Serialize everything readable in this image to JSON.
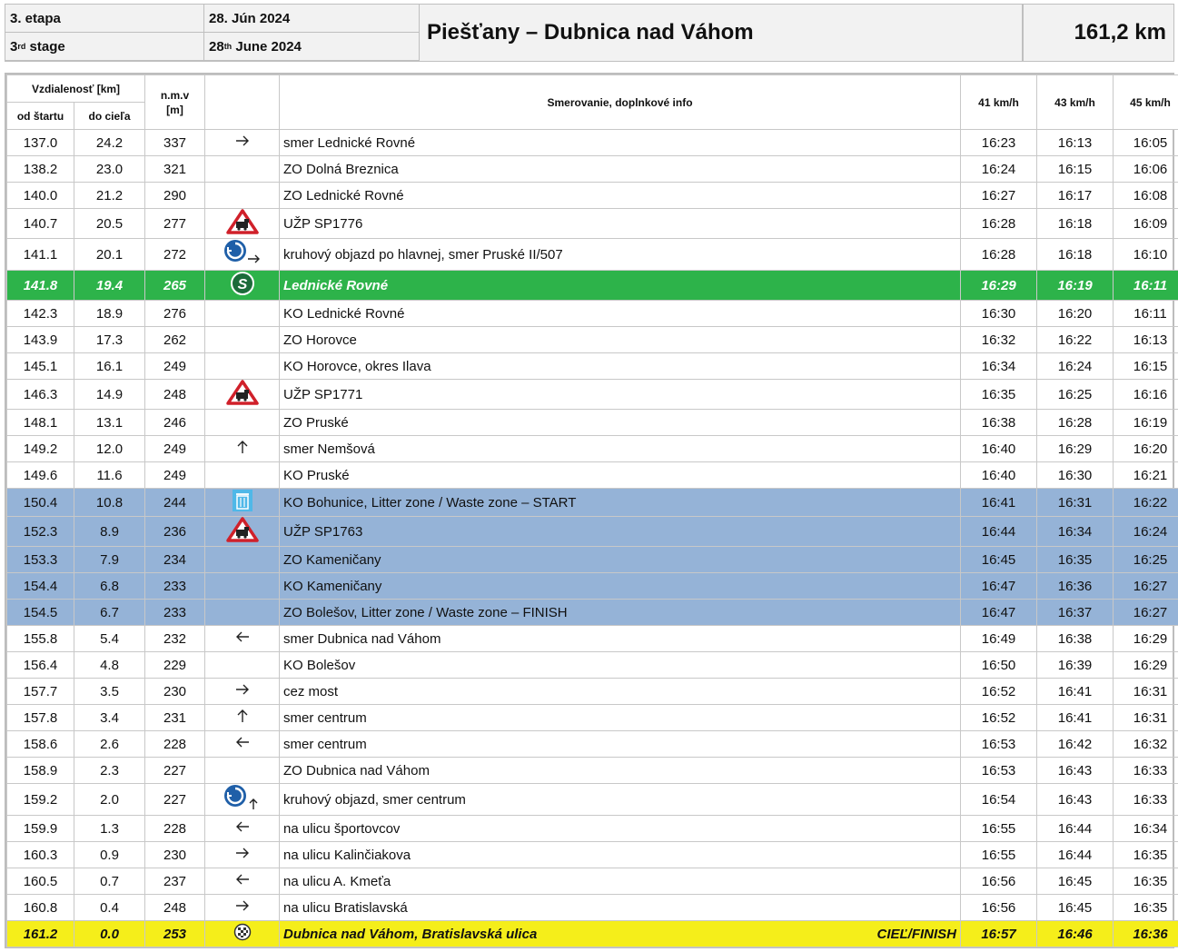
{
  "header": {
    "etapa_sk": "3. etapa",
    "etapa_en_num": "3",
    "etapa_en_sup": "rd",
    "etapa_en_word": " stage",
    "date_sk": "28. Jún 2024",
    "date_en_num": "28",
    "date_en_sup": "th",
    "date_en_rest": " June 2024",
    "title": "Piešťany – Dubnica nad Váhom",
    "distance": "161,2 km"
  },
  "columns": {
    "vzdialenost": "Vzdialenosť [km]",
    "od_startu": "od štartu",
    "do_ciela": "do cieľa",
    "nmv_1": "n.m.v",
    "nmv_2": "[m]",
    "info": "Smerovanie, doplnkové info",
    "speed1": "41 km/h",
    "speed2": "43 km/h",
    "speed3": "45 km/h"
  },
  "colors": {
    "green": "#2db34a",
    "blue": "#95b3d7",
    "yellow": "#f5ee1a"
  },
  "rows": [
    {
      "od": "137.0",
      "do": "24.2",
      "nmv": "337",
      "icon": "arrow-right-icon",
      "info": "smer Lednické Rovné",
      "t1": "16:23",
      "t2": "16:13",
      "t3": "16:05",
      "style": ""
    },
    {
      "od": "138.2",
      "do": "23.0",
      "nmv": "321",
      "icon": "",
      "info": "ZO Dolná Breznica",
      "t1": "16:24",
      "t2": "16:15",
      "t3": "16:06",
      "style": ""
    },
    {
      "od": "140.0",
      "do": "21.2",
      "nmv": "290",
      "icon": "",
      "info": "ZO Lednické Rovné",
      "t1": "16:27",
      "t2": "16:17",
      "t3": "16:08",
      "style": ""
    },
    {
      "od": "140.7",
      "do": "20.5",
      "nmv": "277",
      "icon": "railway-crossing-icon",
      "info": "UŽP SP1776",
      "t1": "16:28",
      "t2": "16:18",
      "t3": "16:09",
      "style": ""
    },
    {
      "od": "141.1",
      "do": "20.1",
      "nmv": "272",
      "icon": "roundabout-right-icon",
      "info": "kruhový objazd po hlavnej, smer Pruské II/507",
      "t1": "16:28",
      "t2": "16:18",
      "t3": "16:10",
      "style": ""
    },
    {
      "od": "141.8",
      "do": "19.4",
      "nmv": "265",
      "icon": "sprint-icon",
      "info": "Lednické Rovné",
      "t1": "16:29",
      "t2": "16:19",
      "t3": "16:11",
      "style": "green"
    },
    {
      "od": "142.3",
      "do": "18.9",
      "nmv": "276",
      "icon": "",
      "info": "KO Lednické Rovné",
      "t1": "16:30",
      "t2": "16:20",
      "t3": "16:11",
      "style": ""
    },
    {
      "od": "143.9",
      "do": "17.3",
      "nmv": "262",
      "icon": "",
      "info": "ZO Horovce",
      "t1": "16:32",
      "t2": "16:22",
      "t3": "16:13",
      "style": ""
    },
    {
      "od": "145.1",
      "do": "16.1",
      "nmv": "249",
      "icon": "",
      "info": "KO Horovce, okres Ilava",
      "t1": "16:34",
      "t2": "16:24",
      "t3": "16:15",
      "style": ""
    },
    {
      "od": "146.3",
      "do": "14.9",
      "nmv": "248",
      "icon": "railway-crossing-icon",
      "info": "UŽP SP1771",
      "t1": "16:35",
      "t2": "16:25",
      "t3": "16:16",
      "style": ""
    },
    {
      "od": "148.1",
      "do": "13.1",
      "nmv": "246",
      "icon": "",
      "info": "ZO Pruské",
      "t1": "16:38",
      "t2": "16:28",
      "t3": "16:19",
      "style": ""
    },
    {
      "od": "149.2",
      "do": "12.0",
      "nmv": "249",
      "icon": "arrow-up-icon",
      "info": "smer Nemšová",
      "t1": "16:40",
      "t2": "16:29",
      "t3": "16:20",
      "style": ""
    },
    {
      "od": "149.6",
      "do": "11.6",
      "nmv": "249",
      "icon": "",
      "info": "KO Pruské",
      "t1": "16:40",
      "t2": "16:30",
      "t3": "16:21",
      "style": ""
    },
    {
      "od": "150.4",
      "do": "10.8",
      "nmv": "244",
      "icon": "trash-icon",
      "info": "KO Bohunice, Litter zone / Waste zone – START",
      "t1": "16:41",
      "t2": "16:31",
      "t3": "16:22",
      "style": "blue"
    },
    {
      "od": "152.3",
      "do": "8.9",
      "nmv": "236",
      "icon": "railway-crossing-icon",
      "info": "UŽP SP1763",
      "t1": "16:44",
      "t2": "16:34",
      "t3": "16:24",
      "style": "blue"
    },
    {
      "od": "153.3",
      "do": "7.9",
      "nmv": "234",
      "icon": "",
      "info": "ZO Kameničany",
      "t1": "16:45",
      "t2": "16:35",
      "t3": "16:25",
      "style": "blue"
    },
    {
      "od": "154.4",
      "do": "6.8",
      "nmv": "233",
      "icon": "",
      "info": "KO Kameničany",
      "t1": "16:47",
      "t2": "16:36",
      "t3": "16:27",
      "style": "blue"
    },
    {
      "od": "154.5",
      "do": "6.7",
      "nmv": "233",
      "icon": "",
      "info": "ZO Bolešov, Litter zone / Waste zone – FINISH",
      "t1": "16:47",
      "t2": "16:37",
      "t3": "16:27",
      "style": "blue"
    },
    {
      "od": "155.8",
      "do": "5.4",
      "nmv": "232",
      "icon": "arrow-left-icon",
      "info": "smer Dubnica nad Váhom",
      "t1": "16:49",
      "t2": "16:38",
      "t3": "16:29",
      "style": ""
    },
    {
      "od": "156.4",
      "do": "4.8",
      "nmv": "229",
      "icon": "",
      "info": "KO Bolešov",
      "t1": "16:50",
      "t2": "16:39",
      "t3": "16:29",
      "style": ""
    },
    {
      "od": "157.7",
      "do": "3.5",
      "nmv": "230",
      "icon": "arrow-right-icon",
      "info": "cez most",
      "t1": "16:52",
      "t2": "16:41",
      "t3": "16:31",
      "style": ""
    },
    {
      "od": "157.8",
      "do": "3.4",
      "nmv": "231",
      "icon": "arrow-up-icon",
      "info": "smer centrum",
      "t1": "16:52",
      "t2": "16:41",
      "t3": "16:31",
      "style": ""
    },
    {
      "od": "158.6",
      "do": "2.6",
      "nmv": "228",
      "icon": "arrow-left-icon",
      "info": "smer centrum",
      "t1": "16:53",
      "t2": "16:42",
      "t3": "16:32",
      "style": ""
    },
    {
      "od": "158.9",
      "do": "2.3",
      "nmv": "227",
      "icon": "",
      "info": "ZO Dubnica nad Váhom",
      "t1": "16:53",
      "t2": "16:43",
      "t3": "16:33",
      "style": ""
    },
    {
      "od": "159.2",
      "do": "2.0",
      "nmv": "227",
      "icon": "roundabout-up-icon",
      "info": "kruhový objazd, smer centrum",
      "t1": "16:54",
      "t2": "16:43",
      "t3": "16:33",
      "style": ""
    },
    {
      "od": "159.9",
      "do": "1.3",
      "nmv": "228",
      "icon": "arrow-left-icon",
      "info": "na ulicu športovcov",
      "t1": "16:55",
      "t2": "16:44",
      "t3": "16:34",
      "style": ""
    },
    {
      "od": "160.3",
      "do": "0.9",
      "nmv": "230",
      "icon": "arrow-right-icon",
      "info": "na ulicu Kalinčiakova",
      "t1": "16:55",
      "t2": "16:44",
      "t3": "16:35",
      "style": ""
    },
    {
      "od": "160.5",
      "do": "0.7",
      "nmv": "237",
      "icon": "arrow-left-icon",
      "info": "na ulicu A. Kmeťa",
      "t1": "16:56",
      "t2": "16:45",
      "t3": "16:35",
      "style": ""
    },
    {
      "od": "160.8",
      "do": "0.4",
      "nmv": "248",
      "icon": "arrow-right-icon",
      "info": "na ulicu Bratislavská",
      "t1": "16:56",
      "t2": "16:45",
      "t3": "16:35",
      "style": ""
    },
    {
      "od": "161.2",
      "do": "0.0",
      "nmv": "253",
      "icon": "finish-flag-icon",
      "info": "Dubnica nad Váhom, Bratislavská ulica",
      "info_right": "CIEĽ/FINISH",
      "t1": "16:57",
      "t2": "16:46",
      "t3": "16:36",
      "style": "yellow"
    }
  ]
}
